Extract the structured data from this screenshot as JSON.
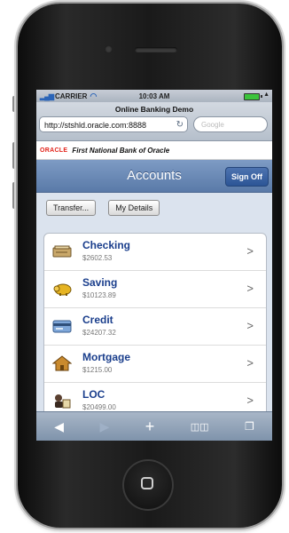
{
  "status": {
    "carrier": "CARRIER",
    "time": "10:03 AM"
  },
  "browser": {
    "page_title": "Online Banking Demo",
    "url": "http://stshld.oracle.com:8888",
    "search_placeholder": "Google"
  },
  "brand": {
    "logo": "ORACLE",
    "bank_name": "First National Bank of Oracle"
  },
  "header": {
    "title": "Accounts",
    "sign_off": "Sign Off"
  },
  "actions": {
    "transfer": "Transfer...",
    "details": "My Details"
  },
  "accounts": [
    {
      "name": "Checking",
      "balance": "$2602.53",
      "icon": "checkbook-icon"
    },
    {
      "name": "Saving",
      "balance": "$10123.89",
      "icon": "piggy-bank-icon"
    },
    {
      "name": "Credit",
      "balance": "$24207.32",
      "icon": "credit-card-icon"
    },
    {
      "name": "Mortgage",
      "balance": "$1215.00",
      "icon": "house-icon"
    },
    {
      "name": "LOC",
      "balance": "$20499.00",
      "icon": "loc-icon"
    }
  ],
  "colors": {
    "accent": "#1a3e8c",
    "header": "#6b88b5",
    "oracle_red": "#e2231a"
  }
}
